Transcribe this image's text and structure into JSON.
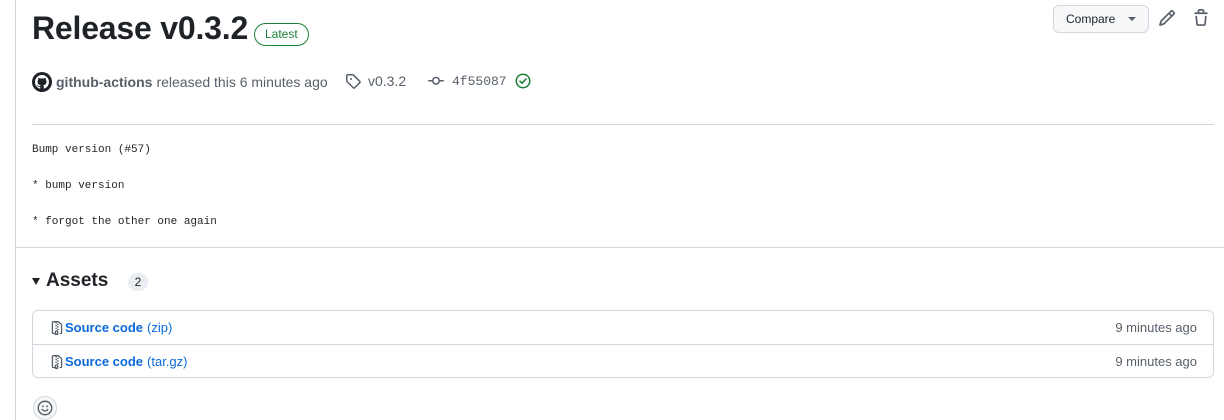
{
  "release": {
    "title": "Release v0.3.2",
    "badge": "Latest",
    "author": "github-actions",
    "released_text": "released this 6 minutes ago",
    "tag": "v0.3.2",
    "commit": "4f55087"
  },
  "toolbar": {
    "compare_label": "Compare"
  },
  "notes": [
    "Bump version (#57)",
    "* bump version",
    "* forgot the other one again"
  ],
  "assets": {
    "title": "Assets",
    "count": "2",
    "items": [
      {
        "name": "Source code",
        "ext": "(zip)",
        "time": "9 minutes ago"
      },
      {
        "name": "Source code",
        "ext": "(tar.gz)",
        "time": "9 minutes ago"
      }
    ]
  },
  "colors": {
    "accent": "#0969da",
    "success": "#1a7f37",
    "border": "#d0d7de",
    "muted": "#57606a"
  }
}
